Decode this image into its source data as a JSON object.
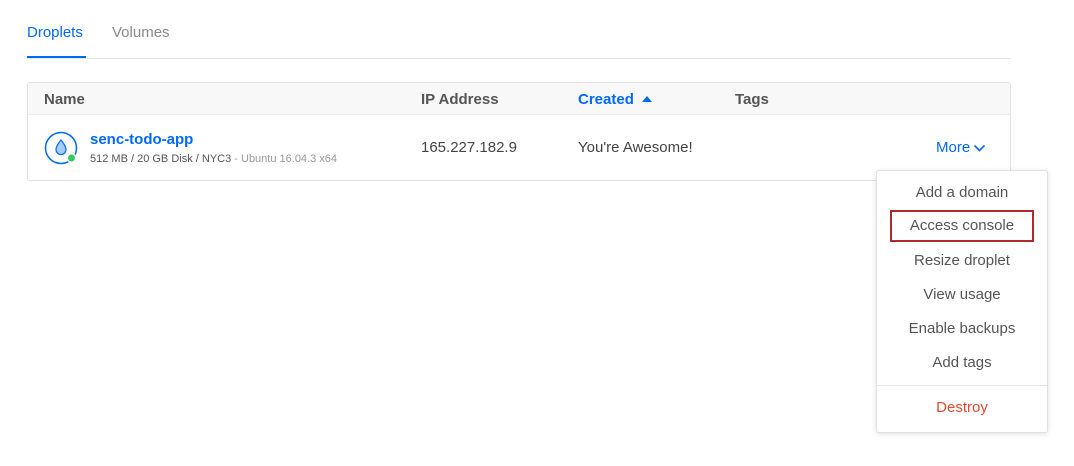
{
  "tabs": [
    {
      "label": "Droplets",
      "active": true
    },
    {
      "label": "Volumes",
      "active": false
    }
  ],
  "table": {
    "columns": {
      "name": "Name",
      "ip": "IP Address",
      "created": "Created",
      "tags": "Tags"
    },
    "sorted_column": "Created",
    "sort_direction": "ascending",
    "rows": [
      {
        "name": "senc-todo-app",
        "specs": "512 MB / 20 GB Disk / NYC3",
        "os": " - Ubuntu 16.04.3 x64",
        "ip": "165.227.182.9",
        "created": "You're Awesome!",
        "tags": "",
        "status": "active",
        "more_label": "More"
      }
    ]
  },
  "dropdown": {
    "items": [
      {
        "label": "Add a domain"
      },
      {
        "label": "Access console",
        "highlighted": true
      },
      {
        "label": "Resize droplet"
      },
      {
        "label": "View usage"
      },
      {
        "label": "Enable backups"
      },
      {
        "label": "Add tags"
      }
    ],
    "danger_item": {
      "label": "Destroy"
    }
  },
  "colors": {
    "accent": "#0069ff",
    "status_active": "#2fcd5a",
    "danger": "#e8492f",
    "highlight_border": "#b02a2a"
  },
  "icons": {
    "droplet": "droplet-icon",
    "chevron": "chevron-down-icon",
    "sort": "sort-ascending-icon"
  }
}
